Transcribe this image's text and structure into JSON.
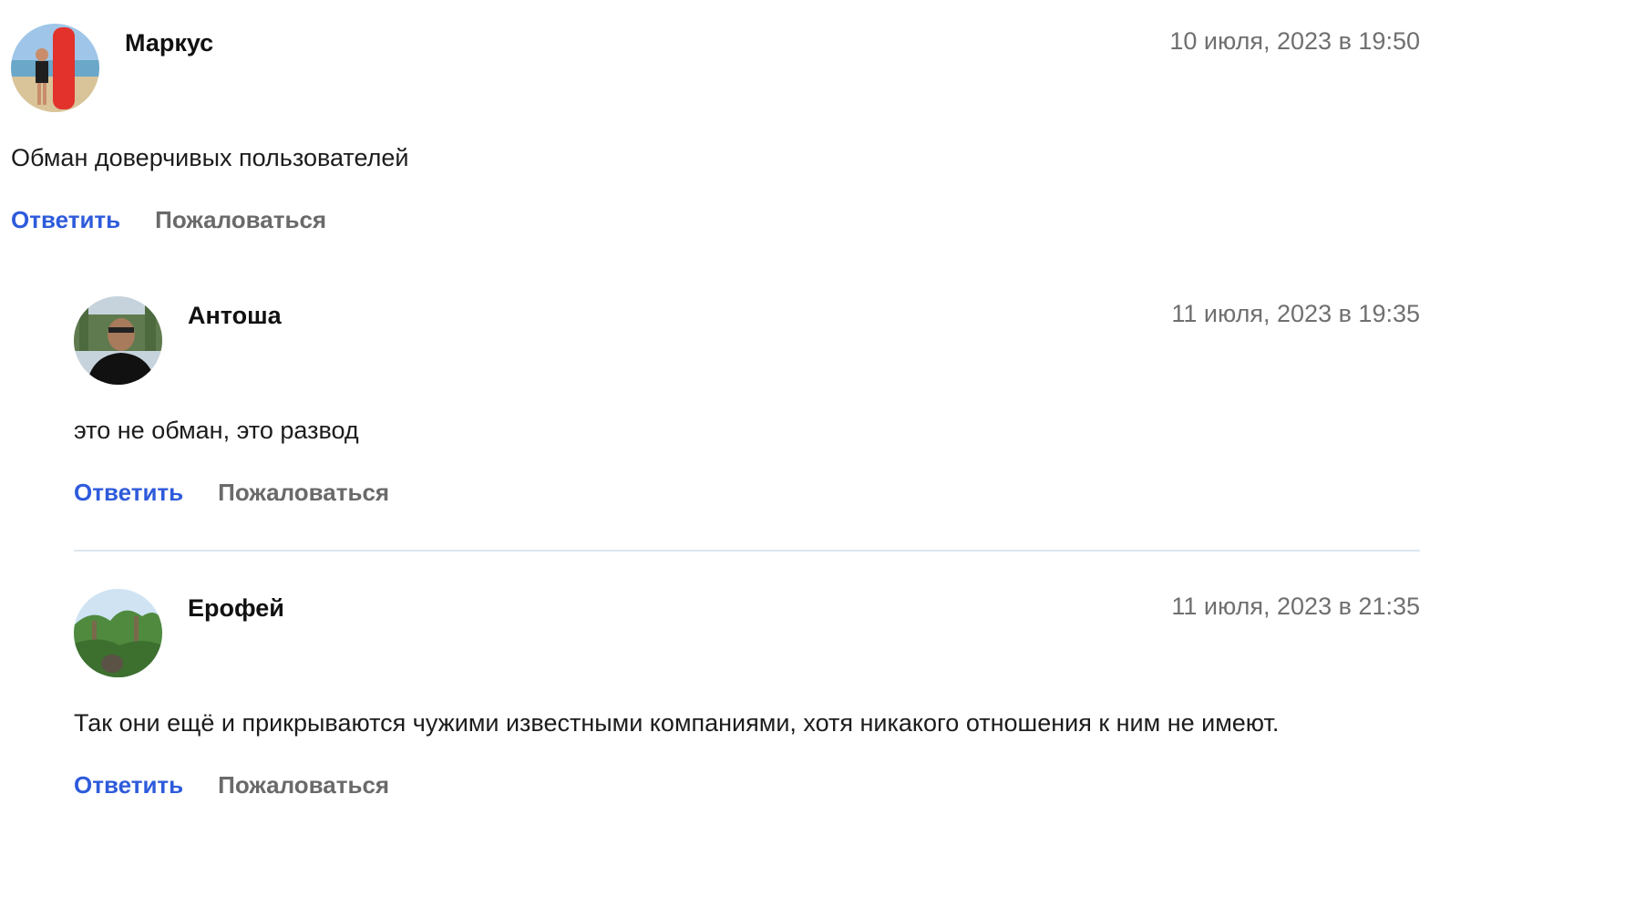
{
  "comments": [
    {
      "author": "Маркус",
      "date": "10 июля, 2023 в 19:50",
      "text": "Обман доверчивых пользователей",
      "reply_label": "Ответить",
      "report_label": "Пожаловаться"
    },
    {
      "author": "Антоша",
      "date": "11 июля, 2023 в 19:35",
      "text": "это не обман, это развод",
      "reply_label": "Ответить",
      "report_label": "Пожаловаться"
    },
    {
      "author": "Ерофей",
      "date": "11 июля, 2023 в 21:35",
      "text": "Так они ещё и прикрываются чужими известными компаниями, хотя никакого отношения к ним не имеют.",
      "reply_label": "Ответить",
      "report_label": "Пожаловаться"
    }
  ],
  "colors": {
    "reply_link": "#2e5bdb",
    "report_link": "#6a6a6a",
    "date_text": "#6f6f6f",
    "divider": "#dde6ee"
  }
}
